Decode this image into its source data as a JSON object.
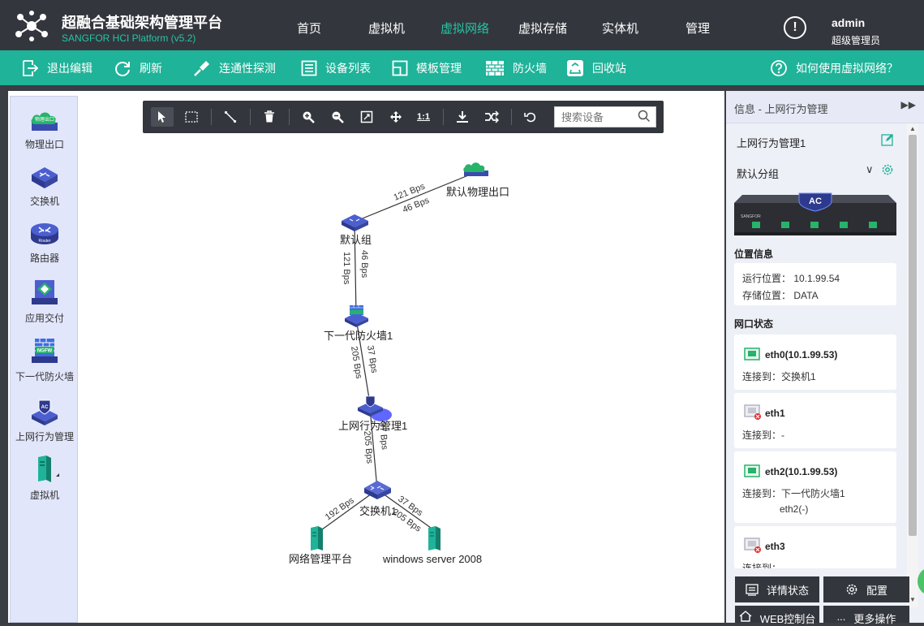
{
  "header": {
    "title": "超融合基础架构管理平台",
    "subtitle": "SANGFOR HCI Platform (v5.2)",
    "nav": [
      "首页",
      "虚拟机",
      "虚拟网络",
      "虚拟存储",
      "实体机",
      "管理"
    ],
    "active_nav": "虚拟网络",
    "user": "admin",
    "role": "超级管理员"
  },
  "toolbar": {
    "exit": "退出编辑",
    "refresh": "刷新",
    "probe": "连通性探测",
    "devices": "设备列表",
    "templates": "模板管理",
    "firewall": "防火墙",
    "recycle": "回收站",
    "help": "如何使用虚拟网络？"
  },
  "palette": [
    "物理出口",
    "交换机",
    "路由器",
    "应用交付",
    "下一代防火墙",
    "上网行为管理",
    "虚拟机"
  ],
  "palette_icon_text": {
    "cloud": "物理出口",
    "router": "Router",
    "ngfw": "NGFW",
    "ac": "AC"
  },
  "canvas_tools": {
    "one_to_one": "1:1",
    "search_placeholder": "搜索设备"
  },
  "topology": {
    "nodes": {
      "exit": "默认物理出口",
      "group": "默认组",
      "ngfw": "下一代防火墙1",
      "ac": "上网行为管理1",
      "switch": "交换机1",
      "netmgmt": "网络管理平台",
      "winsrv": "windows server 2008"
    },
    "edges": {
      "group_exit_up": "121 Bps",
      "group_exit_down": "46 Bps",
      "group_ngfw_a": "121 Bps",
      "group_ngfw_b": "46 Bps",
      "ngfw_ac_a": "205 Bps",
      "ngfw_ac_b": "37 Bps",
      "ac_switch_a": "205 Bps",
      "ac_switch_b": "37 Bps",
      "switch_netmgmt": "192 Bps",
      "switch_winsrv_a": "37 Bps",
      "switch_winsrv_b": "205 Bps"
    }
  },
  "side_panel": {
    "header": "信息 - 上网行为管理",
    "device_name": "上网行为管理1",
    "group": "默认分组",
    "device_badge": "AC",
    "device_brand": "SANGFOR",
    "location_title": "位置信息",
    "run_location_label": "运行位置：",
    "run_location": "10.1.99.54",
    "storage_label": "存储位置：",
    "storage": "DATA",
    "port_title": "网口状态",
    "ports": [
      {
        "name": "eth0(10.1.99.53)",
        "conn": "连接到：交换机1",
        "status": "up"
      },
      {
        "name": "eth1",
        "conn": "连接到：-",
        "status": "down"
      },
      {
        "name": "eth2(10.1.99.53)",
        "conn": "连接到：下一代防火墙1",
        "extra": "eth2(-)",
        "status": "up"
      },
      {
        "name": "eth3",
        "conn": "连接到：-",
        "status": "down"
      }
    ],
    "buttons": [
      "详情状态",
      "配置",
      "WEB控制台",
      "更多操作"
    ]
  }
}
